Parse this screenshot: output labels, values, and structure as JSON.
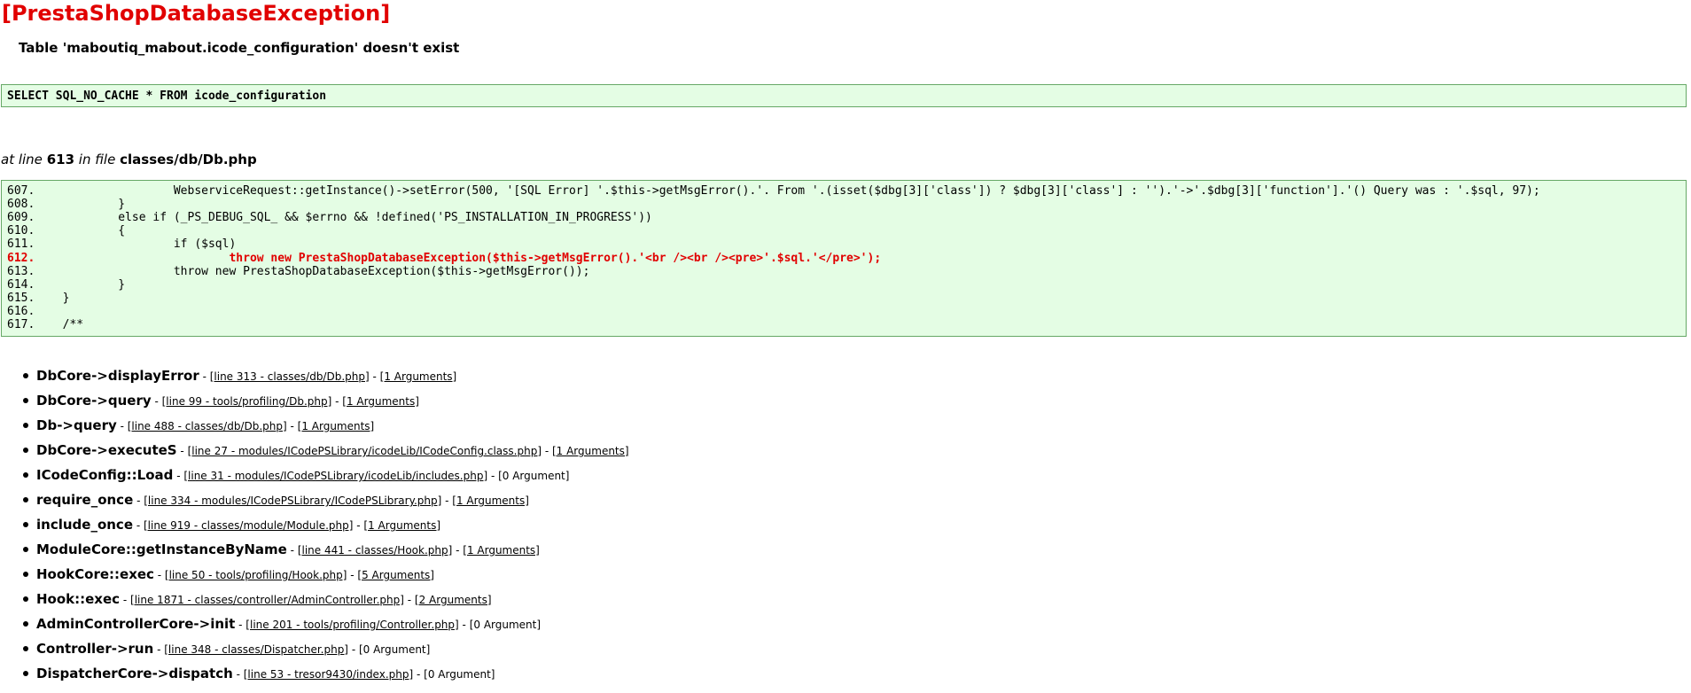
{
  "error": {
    "title": "[PrestaShopDatabaseException]",
    "message": "Table 'maboutiq_mabout.icode_configuration' doesn't exist",
    "sql": "SELECT SQL_NO_CACHE * FROM icode_configuration"
  },
  "location": {
    "at_line_text": "at line",
    "line_number": "613",
    "in_file_text": "in file",
    "file": "classes/db/Db.php"
  },
  "code": [
    {
      "num": "607.",
      "text": "                    WebserviceRequest::getInstance()->setError(500, '[SQL Error] '.$this->getMsgError().'. From '.(isset($dbg[3]['class']) ? $dbg[3]['class'] : '').'->'.$dbg[3]['function'].'() Query was : '.$sql, 97);",
      "highlight": false
    },
    {
      "num": "608.",
      "text": "            }",
      "highlight": false
    },
    {
      "num": "609.",
      "text": "            else if (_PS_DEBUG_SQL_ && $errno && !defined('PS_INSTALLATION_IN_PROGRESS'))",
      "highlight": false
    },
    {
      "num": "610.",
      "text": "            {",
      "highlight": false
    },
    {
      "num": "611.",
      "text": "                    if ($sql)",
      "highlight": false
    },
    {
      "num": "612.",
      "text": "                            throw new PrestaShopDatabaseException($this->getMsgError().'<br /><br /><pre>'.$sql.'</pre>');",
      "highlight": true
    },
    {
      "num": "613.",
      "text": "                    throw new PrestaShopDatabaseException($this->getMsgError());",
      "highlight": false
    },
    {
      "num": "614.",
      "text": "            }",
      "highlight": false
    },
    {
      "num": "615.",
      "text": "    }",
      "highlight": false
    },
    {
      "num": "616.",
      "text": "",
      "highlight": false
    },
    {
      "num": "617.",
      "text": "    /**",
      "highlight": false
    }
  ],
  "trace": [
    {
      "fn": "DbCore->displayError",
      "file": "[line 313 - classes/db/Db.php]",
      "args": "[1 Arguments]",
      "args_link": true
    },
    {
      "fn": "DbCore->query",
      "file": "[line 99 - tools/profiling/Db.php]",
      "args": "[1 Arguments]",
      "args_link": true
    },
    {
      "fn": "Db->query",
      "file": "[line 488 - classes/db/Db.php]",
      "args": "[1 Arguments]",
      "args_link": true
    },
    {
      "fn": "DbCore->executeS",
      "file": "[line 27 - modules/ICodePSLibrary/icodeLib/ICodeConfig.class.php]",
      "args": "[1 Arguments]",
      "args_link": true
    },
    {
      "fn": "ICodeConfig::Load",
      "file": "[line 31 - modules/ICodePSLibrary/icodeLib/includes.php]",
      "args": "[0 Argument]",
      "args_link": false
    },
    {
      "fn": "require_once",
      "file": "[line 334 - modules/ICodePSLibrary/ICodePSLibrary.php]",
      "args": "[1 Arguments]",
      "args_link": true
    },
    {
      "fn": "include_once",
      "file": "[line 919 - classes/module/Module.php]",
      "args": "[1 Arguments]",
      "args_link": true
    },
    {
      "fn": "ModuleCore::getInstanceByName",
      "file": "[line 441 - classes/Hook.php]",
      "args": "[1 Arguments]",
      "args_link": true
    },
    {
      "fn": "HookCore::exec",
      "file": "[line 50 - tools/profiling/Hook.php]",
      "args": "[5 Arguments]",
      "args_link": true
    },
    {
      "fn": "Hook::exec",
      "file": "[line 1871 - classes/controller/AdminController.php]",
      "args": "[2 Arguments]",
      "args_link": true
    },
    {
      "fn": "AdminControllerCore->init",
      "file": "[line 201 - tools/profiling/Controller.php]",
      "args": "[0 Argument]",
      "args_link": false
    },
    {
      "fn": "Controller->run",
      "file": "[line 348 - classes/Dispatcher.php]",
      "args": "[0 Argument]",
      "args_link": false
    },
    {
      "fn": "DispatcherCore->dispatch",
      "file": "[line 53 - tresor9430/index.php]",
      "args": "[0 Argument]",
      "args_link": false
    }
  ],
  "separator": " - "
}
